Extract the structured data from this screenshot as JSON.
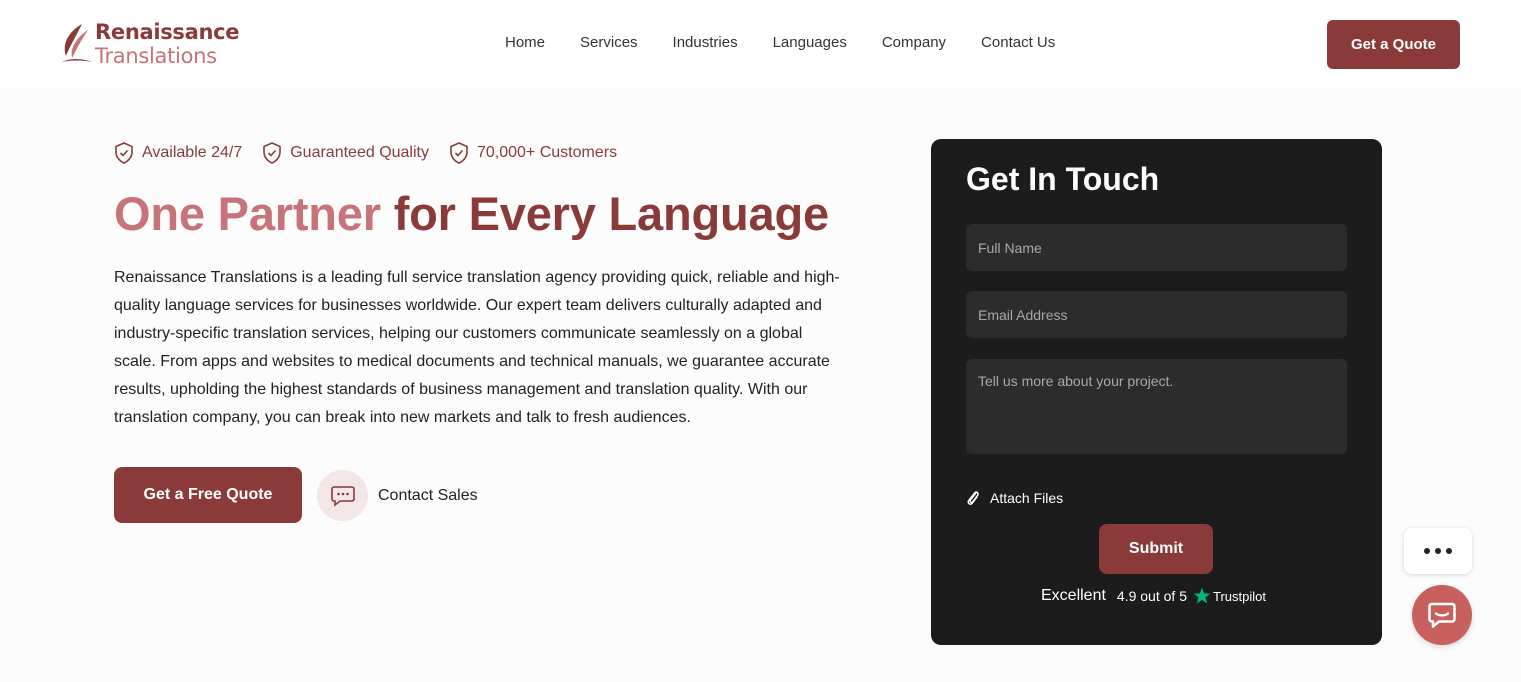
{
  "brand": {
    "name_line1": "Renaissance",
    "name_line2": "Translations",
    "primary_color": "#8b3a3a",
    "accent_color": "#c8727a"
  },
  "nav": {
    "items": [
      {
        "label": "Home"
      },
      {
        "label": "Services"
      },
      {
        "label": "Industries"
      },
      {
        "label": "Languages"
      },
      {
        "label": "Company"
      },
      {
        "label": "Contact Us"
      }
    ],
    "cta_label": "Get a Quote"
  },
  "hero": {
    "badges": [
      {
        "label": "Available 24/7",
        "icon": "shield-check-icon"
      },
      {
        "label": "Guaranteed Quality",
        "icon": "shield-check-icon"
      },
      {
        "label": "70,000+ Customers",
        "icon": "shield-check-icon"
      }
    ],
    "headline_part1": "One Partner",
    "headline_part2": "for Every Language",
    "description": "Renaissance Translations is a leading full service translation agency providing quick, reliable and high-quality language services for businesses worldwide. Our expert team delivers culturally adapted and industry-specific translation services, helping our customers communicate seamlessly on a global scale. From apps and websites to medical documents and technical manuals, we guarantee accurate results, upholding the highest standards of business management and translation quality. With our translation company, you can break into new markets and talk to fresh audiences.",
    "primary_button": "Get a Free Quote",
    "secondary_button": "Contact Sales",
    "secondary_icon": "chat-icon"
  },
  "form": {
    "title": "Get In Touch",
    "name_placeholder": "Full Name",
    "name_value": "",
    "email_placeholder": "Email Address",
    "email_value": "",
    "message_placeholder": "Tell us more about your project.",
    "message_value": "",
    "attach_label": "Attach Files",
    "attach_icon": "paperclip-icon",
    "submit_label": "Submit",
    "rating_word": "Excellent",
    "rating_score": "4.9 out of 5",
    "rating_source": "Trustpilot",
    "rating_icon": "trustpilot-star-icon",
    "rating_color": "#00b67a"
  },
  "widgets": {
    "more_icon": "more-dots-icon",
    "chat_icon": "chat-bubble-icon"
  }
}
